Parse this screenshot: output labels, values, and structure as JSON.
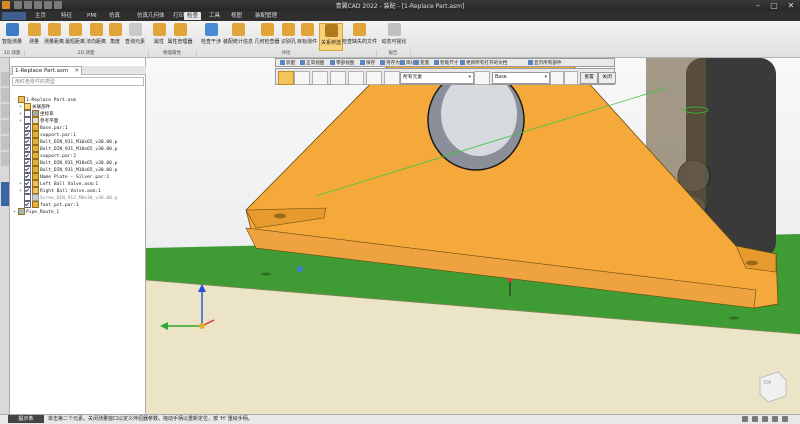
{
  "window": {
    "title": "青翼CAD 2022 - 装配 - [1-Replace Part.asm]",
    "controls": {
      "minimize": "–",
      "maximize": "▢",
      "close": "✕"
    }
  },
  "menu": {
    "items": [
      "主页",
      "特征",
      "PMI",
      "仿真",
      "仿真几何体",
      "打印",
      "检查",
      "工具",
      "视图",
      "装配管理"
    ],
    "active": "检查"
  },
  "ribbon": {
    "buttons": [
      "智能测量",
      "测量",
      "测量距离",
      "最短距离",
      "法向距离",
      "角度",
      "查询元素",
      "属性",
      "属性管理器",
      "检查干涉",
      "装配统计信息",
      "几何检查器",
      "识别孔",
      "目标测件",
      "关系辨选",
      "检查缺失的文件",
      "动态可视化"
    ],
    "selected_button": "关系辨选",
    "groups": [
      "3D 测量",
      "2D 测量",
      "物理属性",
      "评估",
      "报告"
    ]
  },
  "left_panel": {
    "tab_label": "1-Replace Part.asm",
    "close": "✕",
    "search_placeholder": "用红色零件的类型",
    "tree": [
      {
        "text": "1-Replace Part.asm",
        "level": 0,
        "check": false,
        "expand": "-"
      },
      {
        "text": "关联部件",
        "level": 1,
        "check": false,
        "expand": "+"
      },
      {
        "text": "坐标系",
        "level": 1,
        "check": false,
        "expand": "+"
      },
      {
        "text": "参考平面",
        "level": 1,
        "check": false,
        "expand": "+"
      },
      {
        "text": "Base.par:1",
        "level": 1,
        "check": true,
        "expand": ""
      },
      {
        "text": "support.par:1",
        "level": 1,
        "check": true,
        "expand": ""
      },
      {
        "text": "Bolt_DIN_931_M10x65_v30.00.p",
        "level": 1,
        "check": true,
        "expand": ""
      },
      {
        "text": "Bolt_DIN_931_M10x65_v30.00.p",
        "level": 1,
        "check": true,
        "expand": ""
      },
      {
        "text": "support.par:2",
        "level": 1,
        "check": true,
        "expand": ""
      },
      {
        "text": "Bolt_DIN_931_M10x65_v30.00.p",
        "level": 1,
        "check": true,
        "expand": ""
      },
      {
        "text": "Bolt_DIN_931_M10x65_v30.00.p",
        "level": 1,
        "check": true,
        "expand": ""
      },
      {
        "text": "Name Plate - Silver.par:1",
        "level": 1,
        "check": true,
        "expand": ""
      },
      {
        "text": "Left Ball Valve.asm:1",
        "level": 1,
        "check": true,
        "expand": "+"
      },
      {
        "text": "Right Ball Valve.asm:1",
        "level": 1,
        "check": true,
        "expand": "+"
      },
      {
        "text": "Screw_DIN_912_M8x30_v30.00.p",
        "level": 1,
        "check": false,
        "expand": ""
      },
      {
        "text": "foot_pct.par:1",
        "level": 1,
        "check": true,
        "expand": ""
      },
      {
        "text": "Pipe_Route_1",
        "level": 0,
        "check": false,
        "expand": "+"
      }
    ]
  },
  "toolbar1": {
    "items": [
      "装配",
      "正常视图",
      "零部视图",
      "保存",
      "另存为",
      "简化",
      "变量",
      "智能尺寸",
      "更新所有打开的文档",
      "显示所有部件"
    ]
  },
  "toolbar2": {
    "filter1": "所有元素",
    "filter2": "Base",
    "reset_button": "重置",
    "close_button": "关闭"
  },
  "viewport": {
    "view_cube_label": "TOP"
  },
  "status": {
    "label": "提示条",
    "prompt": "单击第二个元素。关闭测量窗口以定义伴侣器参数。拖动手柄以重新定位，按 'H' 重绘手柄。"
  }
}
